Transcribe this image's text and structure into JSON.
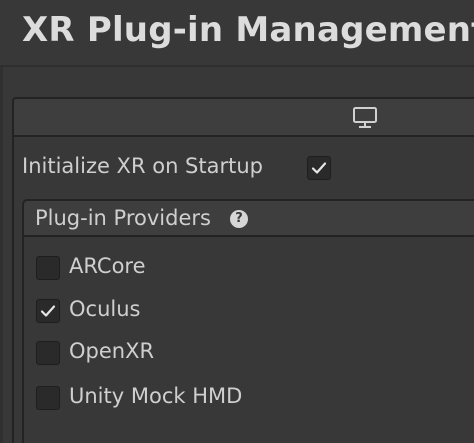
{
  "header": {
    "title": "XR Plug-in Management"
  },
  "tabs": [
    {
      "icon": "monitor-icon",
      "label": ""
    }
  ],
  "settings": {
    "initialize_label": "Initialize XR on Startup",
    "initialize_checked": true
  },
  "providers": {
    "header_label": "Plug-in Providers",
    "help_glyph": "?",
    "items": [
      {
        "label": "ARCore",
        "checked": false
      },
      {
        "label": "Oculus",
        "checked": true
      },
      {
        "label": "OpenXR",
        "checked": false
      },
      {
        "label": "Unity Mock HMD",
        "checked": false
      }
    ]
  },
  "colors": {
    "background": "#383838",
    "header_bg": "#3e3e3e",
    "border": "#232323",
    "text": "#cfcfcf",
    "checkbox_bg": "#2a2a2a",
    "checkmark": "#e6e6e6"
  }
}
